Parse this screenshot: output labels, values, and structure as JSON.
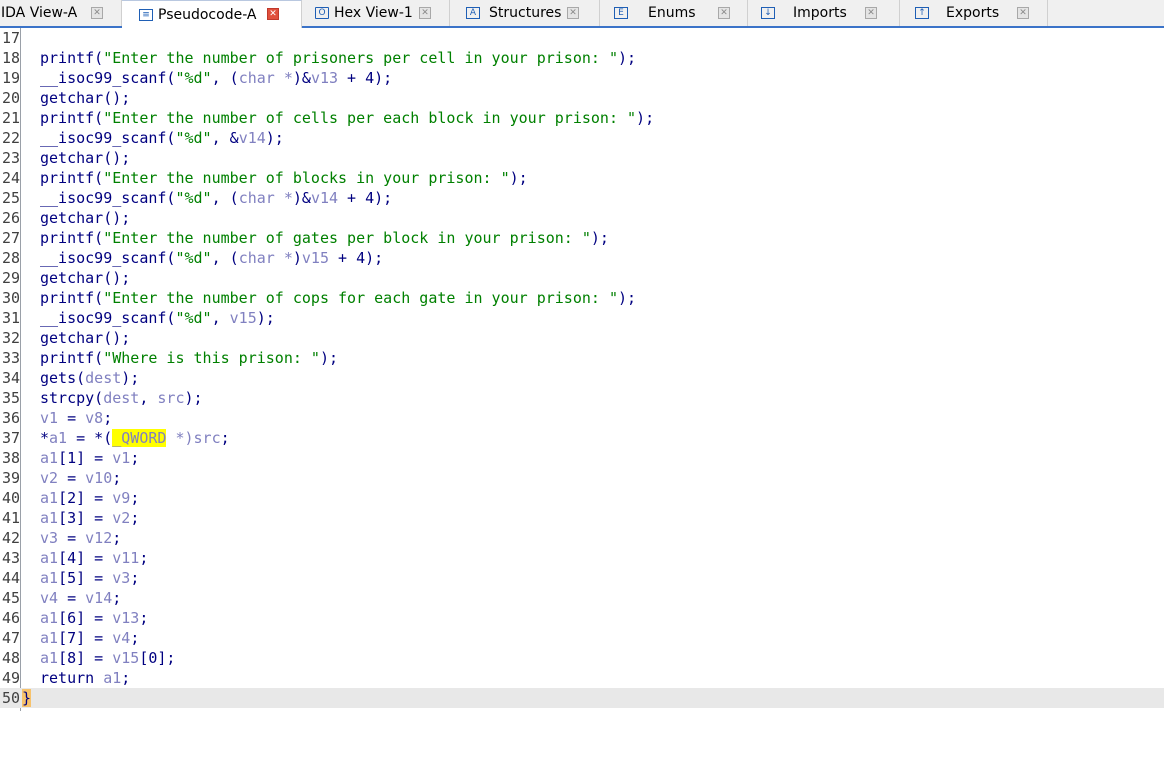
{
  "tabs": [
    {
      "label": "IDA View-A",
      "icon": "ida-view-icon",
      "active": false
    },
    {
      "label": "Pseudocode-A",
      "icon": "pseudocode-icon",
      "active": true
    },
    {
      "label": "Hex View-1",
      "icon": "hex-view-icon",
      "active": false
    },
    {
      "label": "Structures",
      "icon": "structures-icon",
      "active": false
    },
    {
      "label": "Enums",
      "icon": "enums-icon",
      "active": false
    },
    {
      "label": "Imports",
      "icon": "imports-icon",
      "active": false
    },
    {
      "label": "Exports",
      "icon": "exports-icon",
      "active": false
    }
  ],
  "line_numbers": [
    "17",
    "18",
    "19",
    "20",
    "21",
    "22",
    "23",
    "24",
    "25",
    "26",
    "27",
    "28",
    "29",
    "30",
    "31",
    "32",
    "33",
    "34",
    "35",
    "36",
    "37",
    "38",
    "39",
    "40",
    "41",
    "42",
    "43",
    "44",
    "45",
    "46",
    "47",
    "48",
    "49",
    "50"
  ],
  "code": {
    "l18": {
      "fn": "printf(",
      "s": "\"Enter the number of prisoners per cell in your prison: \"",
      "end": ");"
    },
    "l19": {
      "fn": "__isoc99_scanf(",
      "s": "\"%d\"",
      "a": ", (",
      "t": "char *",
      "b": ")&",
      "v": "v13",
      "end": " + 4);"
    },
    "l20": {
      "text": "getchar();"
    },
    "l21": {
      "fn": "printf(",
      "s": "\"Enter the number of cells per each block in your prison: \"",
      "end": ");"
    },
    "l22": {
      "fn": "__isoc99_scanf(",
      "s": "\"%d\"",
      "a": ", &",
      "v": "v14",
      "end": ");"
    },
    "l23": {
      "text": "getchar();"
    },
    "l24": {
      "fn": "printf(",
      "s": "\"Enter the number of blocks in your prison: \"",
      "end": ");"
    },
    "l25": {
      "fn": "__isoc99_scanf(",
      "s": "\"%d\"",
      "a": ", (",
      "t": "char *",
      "b": ")&",
      "v": "v14",
      "end": " + 4);"
    },
    "l26": {
      "text": "getchar();"
    },
    "l27": {
      "fn": "printf(",
      "s": "\"Enter the number of gates per block in your prison: \"",
      "end": ");"
    },
    "l28": {
      "fn": "__isoc99_scanf(",
      "s": "\"%d\"",
      "a": ", (",
      "t": "char *",
      "b": ")",
      "v": "v15",
      "end": " + 4);"
    },
    "l29": {
      "text": "getchar();"
    },
    "l30": {
      "fn": "printf(",
      "s": "\"Enter the number of cops for each gate in your prison: \"",
      "end": ");"
    },
    "l31": {
      "fn": "__isoc99_scanf(",
      "s": "\"%d\"",
      "a": ", ",
      "v": "v15",
      "end": ");"
    },
    "l32": {
      "text": "getchar();"
    },
    "l33": {
      "fn": "printf(",
      "s": "\"Where is this prison: \"",
      "end": ");"
    },
    "l34": {
      "fn": "gets(",
      "v": "dest",
      "end": ");"
    },
    "l35": {
      "fn": "strcpy(",
      "v": "dest",
      "a": ", ",
      "v2": "src",
      "end": ");"
    },
    "l36": {
      "v": "v1",
      "a": " = ",
      "v2": "v8",
      "end": ";"
    },
    "l37": {
      "p": "*",
      "v": "a1",
      "a": " = *(",
      "t": "_QWORD",
      "b": " *)",
      "v2": "src",
      "end": ";"
    },
    "l38": {
      "v": "a1",
      "idx": "[1]",
      "a": " = ",
      "v2": "v1",
      "end": ";"
    },
    "l39": {
      "v": "v2",
      "a": " = ",
      "v2": "v10",
      "end": ";"
    },
    "l40": {
      "v": "a1",
      "idx": "[2]",
      "a": " = ",
      "v2": "v9",
      "end": ";"
    },
    "l41": {
      "v": "a1",
      "idx": "[3]",
      "a": " = ",
      "v2": "v2",
      "end": ";"
    },
    "l42": {
      "v": "v3",
      "a": " = ",
      "v2": "v12",
      "end": ";"
    },
    "l43": {
      "v": "a1",
      "idx": "[4]",
      "a": " = ",
      "v2": "v11",
      "end": ";"
    },
    "l44": {
      "v": "a1",
      "idx": "[5]",
      "a": " = ",
      "v2": "v3",
      "end": ";"
    },
    "l45": {
      "v": "v4",
      "a": " = ",
      "v2": "v14",
      "end": ";"
    },
    "l46": {
      "v": "a1",
      "idx": "[6]",
      "a": " = ",
      "v2": "v13",
      "end": ";"
    },
    "l47": {
      "v": "a1",
      "idx": "[7]",
      "a": " = ",
      "v2": "v4",
      "end": ";"
    },
    "l48": {
      "v": "a1",
      "idx": "[8]",
      "a": " = ",
      "v2": "v15",
      "end": "[0];"
    },
    "l49": {
      "kw": "return ",
      "v": "a1",
      "end": ";"
    },
    "l50": {
      "brace": "}"
    }
  },
  "colors": {
    "accent": "#3b73c8",
    "string": "#008000",
    "keyword": "#000080",
    "variable": "#8080c0",
    "highlight": "#ffff00"
  }
}
